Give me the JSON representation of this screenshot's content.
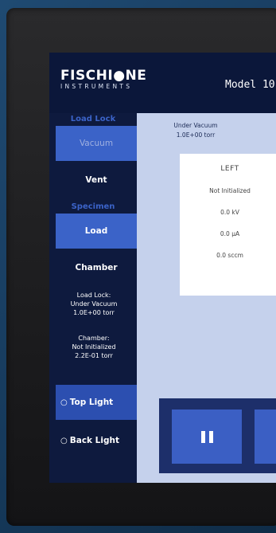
{
  "header": {
    "logo_main": "FISCHI●NE",
    "logo_sub": "INSTRUMENTS",
    "model_title": "Model 10"
  },
  "sidebar": {
    "load_lock_label": "Load Lock",
    "vacuum_button": "Vacuum",
    "vent_button": "Vent",
    "specimen_label": "Specimen",
    "load_button": "Load",
    "chamber_button": "Chamber",
    "load_lock_status": [
      "Load Lock:",
      "Under Vacuum",
      "1.0E+00 torr"
    ],
    "chamber_status": [
      "Chamber:",
      "Not Initialized",
      "2.2E-01 torr"
    ],
    "top_light": "Top Light",
    "back_light": "Back Light"
  },
  "main": {
    "vacuum_state": "Under Vacuum",
    "vacuum_pressure": "1.0E+00 torr",
    "left_card": {
      "title": "LEFT",
      "status": "Not Initialized",
      "voltage": "0.0 kV",
      "current": "0.0 µA",
      "flow": "0.0 sccm"
    }
  },
  "icons": {
    "bulb": "lightbulb-icon",
    "pause": "pause-icon"
  },
  "colors": {
    "accent": "#3b63c8",
    "screen_bg": "#0e1a3e",
    "panel_bg": "#c5d1ec"
  }
}
